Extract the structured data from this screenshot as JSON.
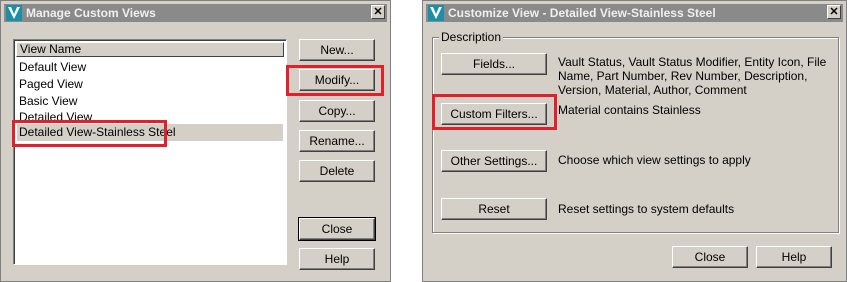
{
  "left_dialog": {
    "title": "Manage Custom Views",
    "close_glyph": "✕",
    "list_header": "View Name",
    "views": [
      "Default View",
      "Paged View",
      "Basic View",
      "Detailed View",
      "Detailed View-Stainless Steel"
    ],
    "selected_view": "Detailed View-Stainless Steel",
    "buttons": {
      "new": "New...",
      "modify": "Modify...",
      "copy": "Copy...",
      "rename": "Rename...",
      "delete": "Delete",
      "close": "Close",
      "help": "Help"
    }
  },
  "right_dialog": {
    "title": "Customize View - Detailed View-Stainless Steel",
    "close_glyph": "✕",
    "group_label": "Description",
    "rows": {
      "fields": {
        "button": "Fields...",
        "text": "Vault Status, Vault Status Modifier, Entity Icon, File Name, Part Number, Rev Number, Description, Version, Material, Author, Comment"
      },
      "custom_filters": {
        "button": "Custom Filters...",
        "text": "Material contains Stainless"
      },
      "other_settings": {
        "button": "Other Settings...",
        "text": "Choose which view settings to apply"
      },
      "reset": {
        "button": "Reset",
        "text": "Reset settings to system defaults"
      }
    },
    "buttons": {
      "close": "Close",
      "help": "Help"
    }
  },
  "highlight_color": "#e0202a",
  "app_icon": "vault-v-icon"
}
